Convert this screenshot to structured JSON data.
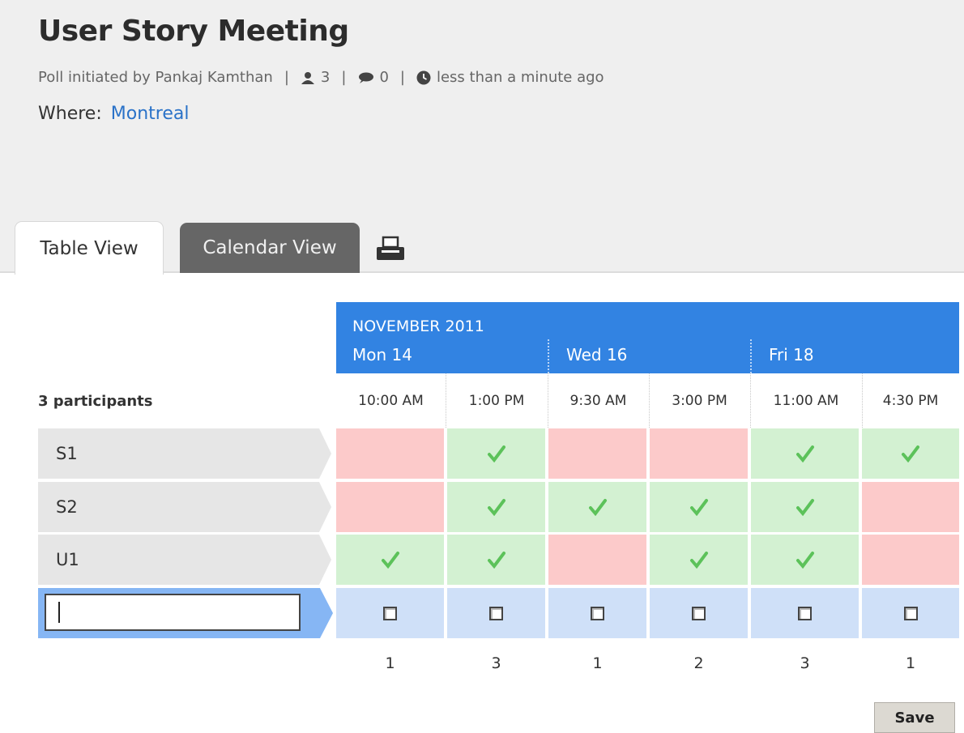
{
  "poll": {
    "title": "User Story Meeting",
    "initiated_by": "Poll initiated by Pankaj Kamthan",
    "participants_count": "3",
    "comments_count": "0",
    "time_ago": "less than a minute ago",
    "where_label": "Where:",
    "location": "Montreal"
  },
  "tabs": {
    "table_view": "Table View",
    "calendar_view": "Calendar View"
  },
  "calendar": {
    "month": "NOVEMBER 2011",
    "days": [
      "Mon 14",
      "Wed 16",
      "Fri 18"
    ],
    "times": [
      "10:00 AM",
      "1:00 PM",
      "9:30 AM",
      "3:00 PM",
      "11:00 AM",
      "4:30 PM"
    ]
  },
  "participants": {
    "label": "3 participants",
    "rows": [
      {
        "name": "S1",
        "answers": [
          false,
          true,
          false,
          false,
          true,
          true
        ]
      },
      {
        "name": "S2",
        "answers": [
          false,
          true,
          true,
          true,
          true,
          false
        ]
      },
      {
        "name": "U1",
        "answers": [
          true,
          true,
          false,
          true,
          true,
          false
        ]
      }
    ]
  },
  "counts": [
    "1",
    "3",
    "1",
    "2",
    "3",
    "1"
  ],
  "actions": {
    "save_label": "Save"
  },
  "colors": {
    "header_blue": "#3283e2",
    "yes": "#d3f1d2",
    "no": "#fccaca",
    "check": "#5cc25a",
    "link": "#2a72c8"
  }
}
